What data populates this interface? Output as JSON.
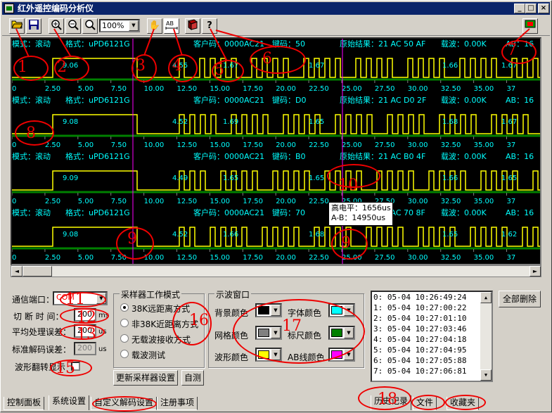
{
  "window": {
    "title": "红外遥控编码分析仪",
    "controls": [
      "_",
      "□",
      "×"
    ]
  },
  "toolbar": {
    "zoom": "100%",
    "tools": [
      "open-icon",
      "save-icon",
      "zoom-in-icon",
      "zoom-out-icon",
      "zoom-fit-icon",
      "hand-icon",
      "ab-measure-icon",
      "book-icon",
      "help-icon",
      "exit-icon"
    ]
  },
  "scope": {
    "tracks": [
      {
        "mode": "模式：滚动",
        "format": "格式：uPD6121G",
        "customer": "客户码：0000AC21",
        "key": "键码：50",
        "raw": "原始结果：21 AC 50 AF",
        "carrier": "载波：0.00K",
        "ab": "AB：16",
        "labels": [
          "9.06",
          "4.55",
          "1.67",
          "1.67",
          "1.66",
          "1.67"
        ]
      },
      {
        "mode": "模式：滚动",
        "format": "格式：uPD6121G",
        "customer": "客户码：0000AC21",
        "key": "键码：D0",
        "raw": "原始结果：21 AC D0 2F",
        "carrier": "载波：0.00K",
        "ab": "AB：16",
        "labels": [
          "9.08",
          "4.52",
          "1.69",
          "1.65",
          "1.68",
          "1.67"
        ]
      },
      {
        "mode": "模式：滚动",
        "format": "格式：uPD6121G",
        "customer": "客户码：0000AC21",
        "key": "键码：B0",
        "raw": "原始结果：21 AC B0 4F",
        "carrier": "载波：0.00K",
        "ab": "AB：16",
        "labels": [
          "9.09",
          "4.49",
          "1.65",
          "1.65",
          "1.66",
          "1.65"
        ]
      },
      {
        "mode": "模式：滚动",
        "format": "格式：uPD6121G",
        "customer": "客户码：0000AC21",
        "key": "键码：70",
        "raw": "原始结果：21 AC 70 8F",
        "carrier": "载波：0.00K",
        "ab": "AB：16",
        "labels": [
          "9.08",
          "4.52",
          "1.66",
          "1.68",
          "1.65",
          "1.62"
        ]
      }
    ],
    "ruler": [
      "0",
      "2.50",
      "5.00",
      "7.50",
      "10.00",
      "12.50",
      "15.00",
      "17.50",
      "20.00",
      "22.50",
      "25.00",
      "27.50",
      "30.00",
      "32.50",
      "35.00",
      "37"
    ],
    "tooltip": {
      "high": "高电平：1656us",
      "ab": "A-B：14950us"
    }
  },
  "settings": {
    "port_label": "通信端口：",
    "port_value": "COM",
    "cutoff_label": "切 断 时 间：",
    "cutoff_value": "200",
    "cutoff_unit": "ms",
    "avg_label": "平均处理误差：",
    "avg_value": "200",
    "avg_unit": "us",
    "std_label": "标准解码误差：",
    "std_value": "200",
    "std_unit": "us",
    "invert_label": "波形翻转显示"
  },
  "sampler": {
    "title": "采样器工作模式",
    "options": [
      "38K远距离方式",
      "非38K近距离方式",
      "无载波接收方式",
      "载波测试"
    ],
    "selected": 0,
    "update_btn": "更新采样器设置",
    "selftest_btn": "自测"
  },
  "scopewin": {
    "title": "示波窗口",
    "bg_label": "背景颜色",
    "font_label": "字体颜色",
    "grid_label": "网格颜色",
    "ruler_label": "标尺颜色",
    "wave_label": "波形颜色",
    "ab_label": "AB线颜色",
    "colors": {
      "bg": "#000000",
      "font": "#00ffff",
      "grid": "#808080",
      "ruler": "#008000",
      "wave": "#ffff00",
      "ab": "#ff00ff"
    }
  },
  "history": {
    "items": [
      "0: 05-04 10:26:49:24",
      "1: 05-04 10:27:00:22",
      "2: 05-04 10:27:01:10",
      "3: 05-04 10:27:03:46",
      "4: 05-04 10:27:04:18",
      "5: 05-04 10:27:04:95",
      "6: 05-04 10:27:05:88",
      "7: 05-04 10:27:06:81"
    ],
    "delete_all": "全部删除"
  },
  "tabs_left": [
    "控制面板",
    "系统设置",
    "自定义解码设置",
    "注册事项"
  ],
  "tabs_right": [
    "历史记录",
    "文件",
    "收藏夹"
  ],
  "annotations": [
    "1",
    "2",
    "3",
    "4",
    "5",
    "6",
    "7",
    "8",
    "9",
    "9",
    "10",
    "11",
    "12",
    "13",
    "15",
    "16",
    "17",
    "18"
  ]
}
